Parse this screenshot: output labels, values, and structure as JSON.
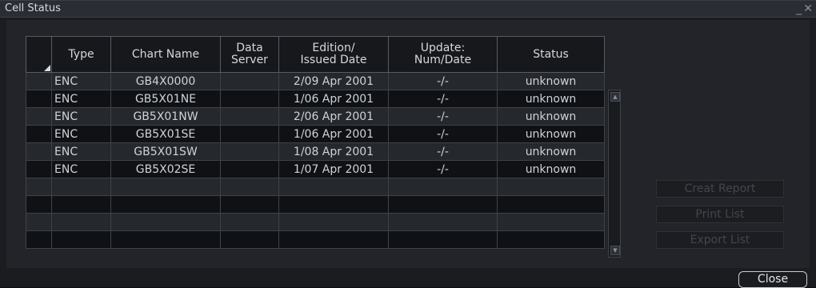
{
  "window": {
    "title": "Cell Status",
    "minimize_glyph": "_",
    "close_glyph": "✕"
  },
  "table": {
    "columns": [
      "",
      "Type",
      "Chart Name",
      "Data\nServer",
      "Edition/\nIssued Date",
      "Update:\nNum/Date",
      "Status"
    ],
    "rows": [
      {
        "type": "ENC",
        "chart": "GB4X0000",
        "server": "",
        "edition": "2/09 Apr 2001",
        "update": "-/-",
        "status": "unknown"
      },
      {
        "type": "ENC",
        "chart": "GB5X01NE",
        "server": "",
        "edition": "1/06 Apr 2001",
        "update": "-/-",
        "status": "unknown"
      },
      {
        "type": "ENC",
        "chart": "GB5X01NW",
        "server": "",
        "edition": "2/06 Apr 2001",
        "update": "-/-",
        "status": "unknown"
      },
      {
        "type": "ENC",
        "chart": "GB5X01SE",
        "server": "",
        "edition": "1/06 Apr 2001",
        "update": "-/-",
        "status": "unknown"
      },
      {
        "type": "ENC",
        "chart": "GB5X01SW",
        "server": "",
        "edition": "1/08 Apr 2001",
        "update": "-/-",
        "status": "unknown"
      },
      {
        "type": "ENC",
        "chart": "GB5X02SE",
        "server": "",
        "edition": "1/07 Apr 2001",
        "update": "-/-",
        "status": "unknown"
      },
      {
        "type": "",
        "chart": "",
        "server": "",
        "edition": "",
        "update": "",
        "status": ""
      },
      {
        "type": "",
        "chart": "",
        "server": "",
        "edition": "",
        "update": "",
        "status": ""
      },
      {
        "type": "",
        "chart": "",
        "server": "",
        "edition": "",
        "update": "",
        "status": ""
      },
      {
        "type": "",
        "chart": "",
        "server": "",
        "edition": "",
        "update": "",
        "status": ""
      }
    ]
  },
  "actions": {
    "create_report": "Creat Report",
    "print_list": "Print List",
    "export_list": "Export List",
    "close": "Close"
  }
}
